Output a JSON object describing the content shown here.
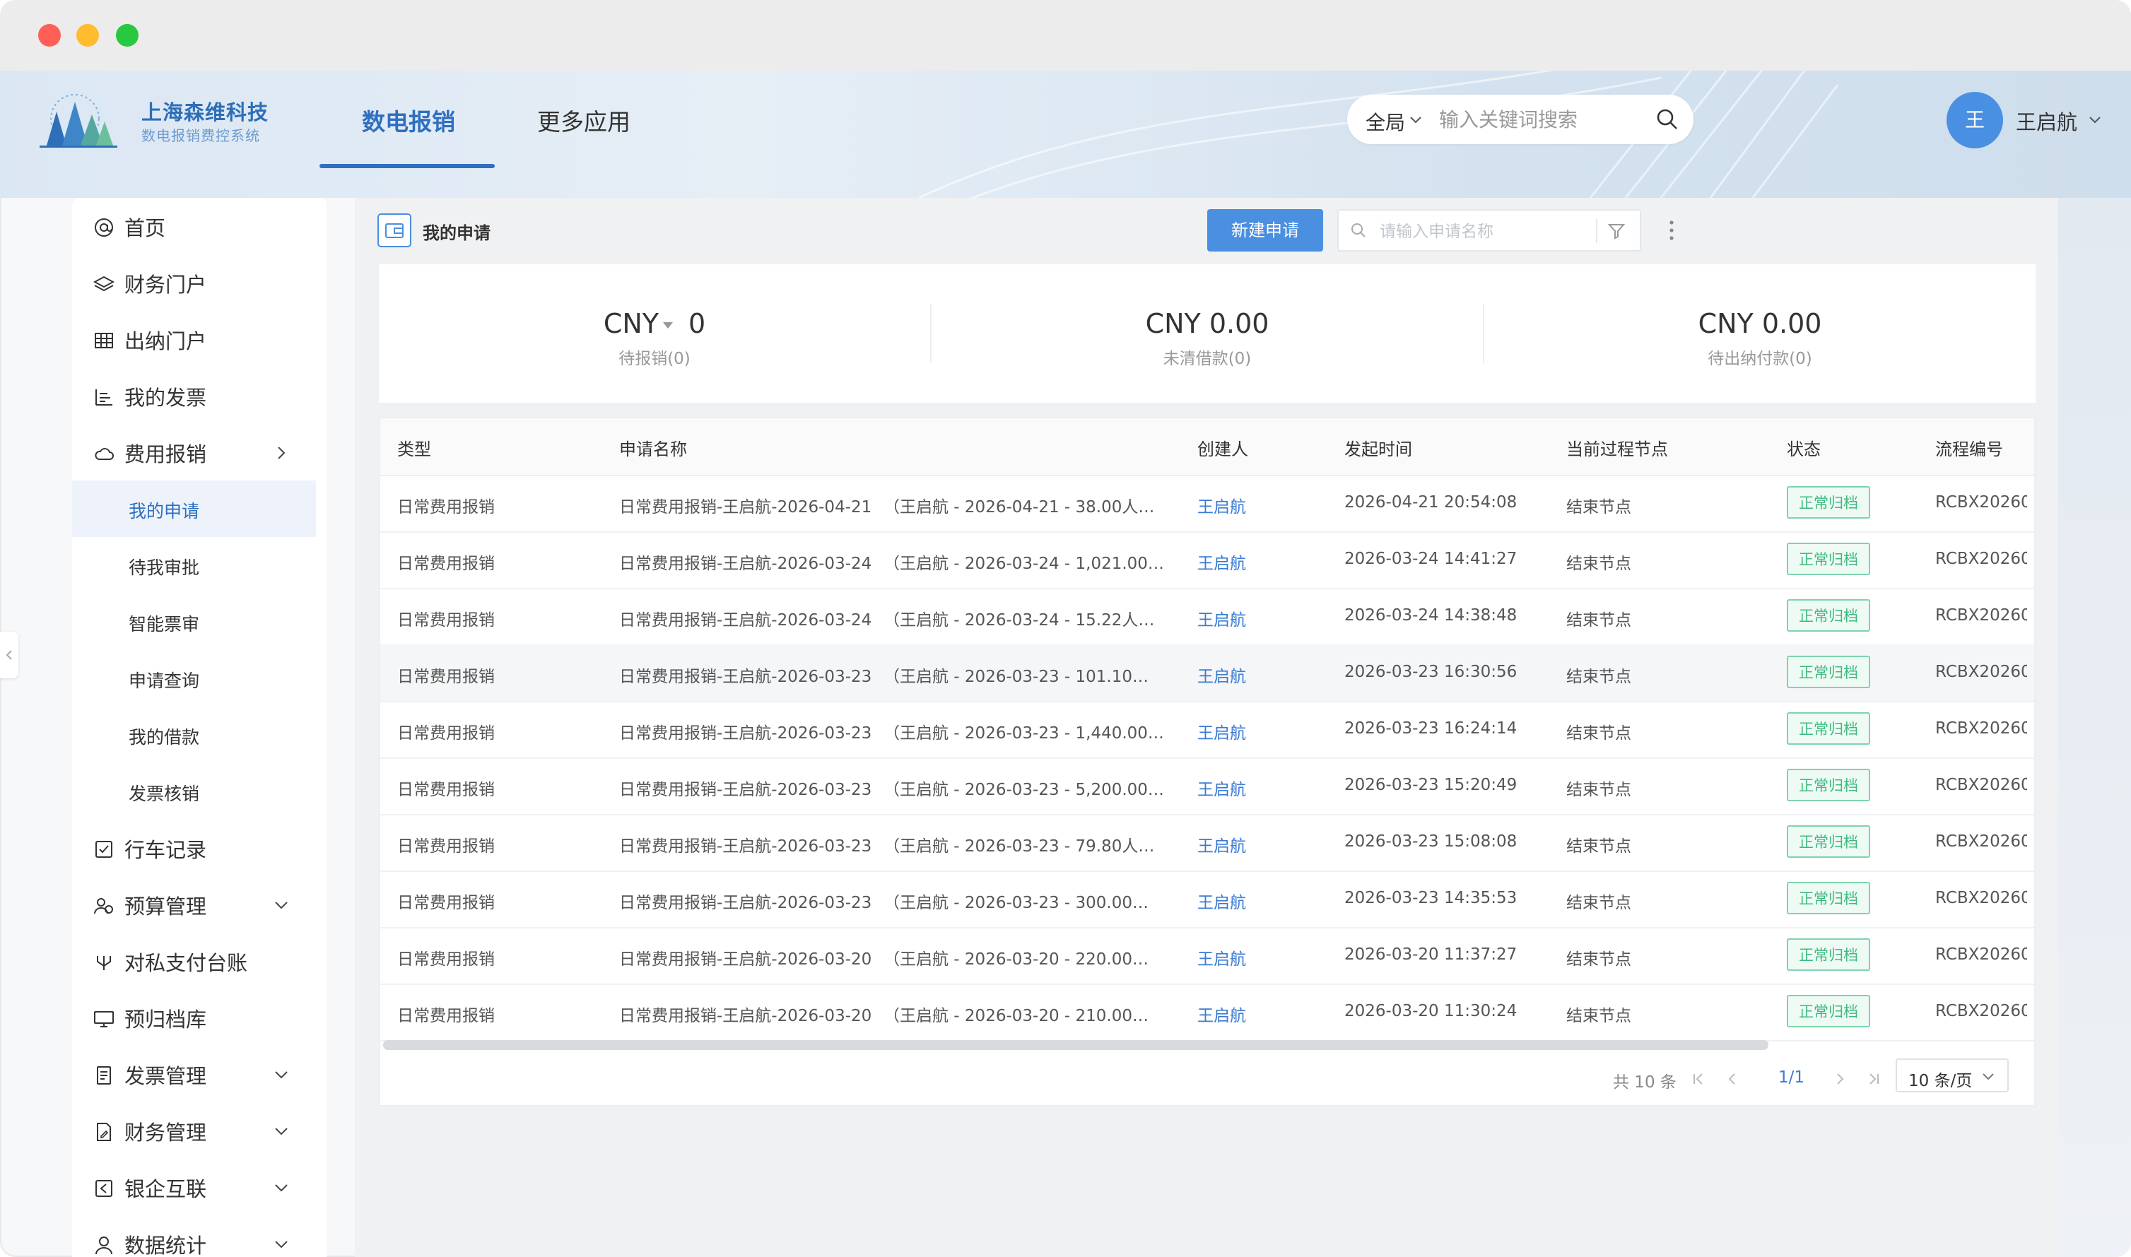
{
  "brand": {
    "name": "上海森维科技",
    "subtitle": "数电报销费控系统"
  },
  "top_nav": {
    "tabs": [
      {
        "label": "数电报销",
        "active": true
      },
      {
        "label": "更多应用",
        "active": false
      }
    ]
  },
  "global_search": {
    "scope": "全局",
    "placeholder": "输入关键词搜索"
  },
  "user": {
    "avatar_text": "王",
    "name": "王启航"
  },
  "sidebar": {
    "items": [
      {
        "label": "首页",
        "icon": "at-icon"
      },
      {
        "label": "财务门户",
        "icon": "layers-icon"
      },
      {
        "label": "出纳门户",
        "icon": "table-icon"
      },
      {
        "label": "我的发票",
        "icon": "bar-list-icon"
      },
      {
        "label": "费用报销",
        "icon": "cloud-icon",
        "arrow": "right"
      },
      {
        "label": "行车记录",
        "icon": "checkbox-icon"
      },
      {
        "label": "预算管理",
        "icon": "users-icon",
        "arrow": "down"
      },
      {
        "label": "对私支付台账",
        "icon": "fork-icon"
      },
      {
        "label": "预归档库",
        "icon": "monitor-icon"
      },
      {
        "label": "发票管理",
        "icon": "doc-list-icon",
        "arrow": "down"
      },
      {
        "label": "财务管理",
        "icon": "doc-edit-icon",
        "arrow": "down"
      },
      {
        "label": "银企互联",
        "icon": "square-left-icon",
        "arrow": "down"
      },
      {
        "label": "数据统计",
        "icon": "user-icon",
        "arrow": "down"
      }
    ],
    "sub_items": [
      {
        "label": "我的申请",
        "active": true
      },
      {
        "label": "待我审批",
        "active": false
      },
      {
        "label": "智能票审",
        "active": false
      },
      {
        "label": "申请查询",
        "active": false
      },
      {
        "label": "我的借款",
        "active": false
      },
      {
        "label": "发票核销",
        "active": false
      }
    ]
  },
  "page": {
    "title": "我的申请",
    "new_button": "新建申请",
    "filter_placeholder": "请输入申请名称"
  },
  "summary": [
    {
      "currency": "CNY",
      "amount": "0",
      "label": "待报销(0)"
    },
    {
      "value": "CNY 0.00",
      "label": "未清借款(0)"
    },
    {
      "value": "CNY 0.00",
      "label": "待出纳付款(0)"
    }
  ],
  "table": {
    "columns": [
      "类型",
      "申请名称",
      "创建人",
      "发起时间",
      "当前过程节点",
      "状态",
      "流程编号"
    ],
    "rows": [
      {
        "type": "日常费用报销",
        "name": "日常费用报销-王启航-2026-04-21",
        "detail": "（王启航 - 2026-04-21 - 38.00人…",
        "creator": "王启航",
        "time": "2026-04-21 20:54:08",
        "node": "结束节点",
        "status": "正常归档",
        "flow_no": "RCBX20260"
      },
      {
        "type": "日常费用报销",
        "name": "日常费用报销-王启航-2026-03-24",
        "detail": "（王启航 - 2026-03-24 - 1,021.00…",
        "creator": "王启航",
        "time": "2026-03-24 14:41:27",
        "node": "结束节点",
        "status": "正常归档",
        "flow_no": "RCBX20260"
      },
      {
        "type": "日常费用报销",
        "name": "日常费用报销-王启航-2026-03-24",
        "detail": "（王启航 - 2026-03-24 - 15.22人…",
        "creator": "王启航",
        "time": "2026-03-24 14:38:48",
        "node": "结束节点",
        "status": "正常归档",
        "flow_no": "RCBX20260"
      },
      {
        "type": "日常费用报销",
        "name": "日常费用报销-王启航-2026-03-23",
        "detail": "（王启航 - 2026-03-23 - 101.10…",
        "creator": "王启航",
        "time": "2026-03-23 16:30:56",
        "node": "结束节点",
        "status": "正常归档",
        "flow_no": "RCBX20260",
        "highlight": true
      },
      {
        "type": "日常费用报销",
        "name": "日常费用报销-王启航-2026-03-23",
        "detail": "（王启航 - 2026-03-23 - 1,440.00…",
        "creator": "王启航",
        "time": "2026-03-23 16:24:14",
        "node": "结束节点",
        "status": "正常归档",
        "flow_no": "RCBX20260"
      },
      {
        "type": "日常费用报销",
        "name": "日常费用报销-王启航-2026-03-23",
        "detail": "（王启航 - 2026-03-23 - 5,200.00…",
        "creator": "王启航",
        "time": "2026-03-23 15:20:49",
        "node": "结束节点",
        "status": "正常归档",
        "flow_no": "RCBX20260"
      },
      {
        "type": "日常费用报销",
        "name": "日常费用报销-王启航-2026-03-23",
        "detail": "（王启航 - 2026-03-23 - 79.80人…",
        "creator": "王启航",
        "time": "2026-03-23 15:08:08",
        "node": "结束节点",
        "status": "正常归档",
        "flow_no": "RCBX20260"
      },
      {
        "type": "日常费用报销",
        "name": "日常费用报销-王启航-2026-03-23",
        "detail": "（王启航 - 2026-03-23 - 300.00…",
        "creator": "王启航",
        "time": "2026-03-23 14:35:53",
        "node": "结束节点",
        "status": "正常归档",
        "flow_no": "RCBX20260"
      },
      {
        "type": "日常费用报销",
        "name": "日常费用报销-王启航-2026-03-20",
        "detail": "（王启航 - 2026-03-20 - 220.00…",
        "creator": "王启航",
        "time": "2026-03-20 11:37:27",
        "node": "结束节点",
        "status": "正常归档",
        "flow_no": "RCBX20260"
      },
      {
        "type": "日常费用报销",
        "name": "日常费用报销-王启航-2026-03-20",
        "detail": "（王启航 - 2026-03-20 - 210.00…",
        "creator": "王启航",
        "time": "2026-03-20 11:30:24",
        "node": "结束节点",
        "status": "正常归档",
        "flow_no": "RCBX20260"
      }
    ]
  },
  "pagination": {
    "total": "共 10 条",
    "page": "1/1",
    "page_size": "10 条/页"
  },
  "colors": {
    "accent": "#2f6fc0",
    "button": "#4a8fe0",
    "status_green": "#3cba7e",
    "avatar": "#4a90e2"
  }
}
